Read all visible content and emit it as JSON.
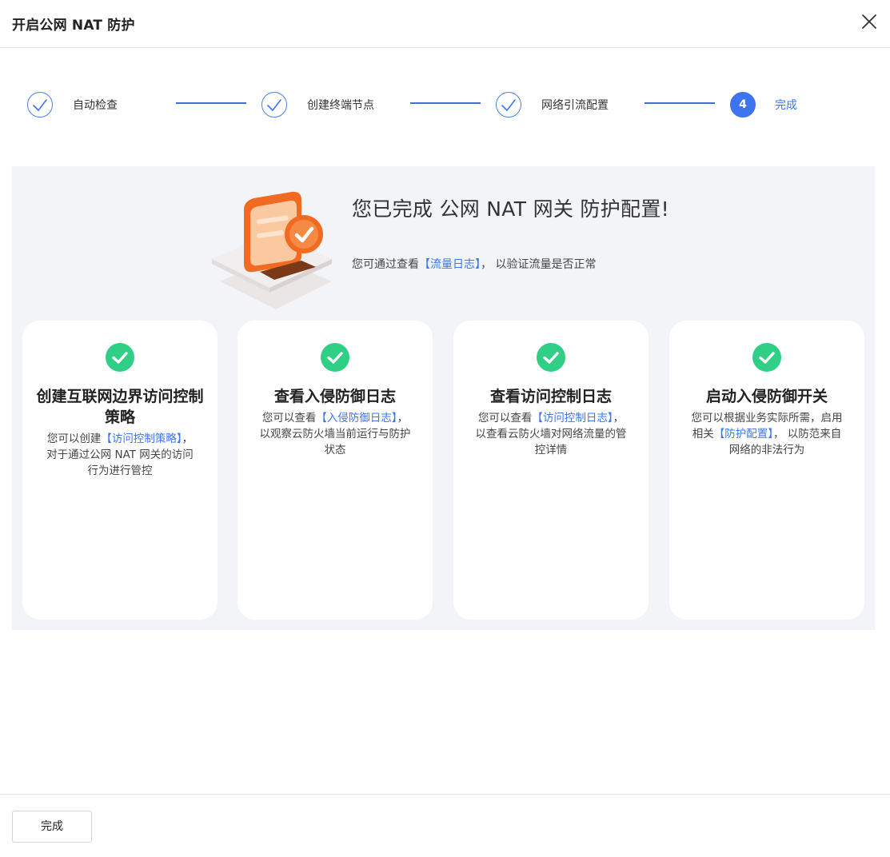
{
  "header": {
    "title": "开启公网 NAT 防护",
    "close_icon": "close-icon"
  },
  "steps": [
    {
      "label": "自动检查",
      "status": "done"
    },
    {
      "label": "创建终端节点",
      "status": "done"
    },
    {
      "label": "网络引流配置",
      "status": "done"
    },
    {
      "number": "4",
      "label": "完成",
      "status": "current"
    }
  ],
  "result": {
    "title": "您已完成 公网 NAT 网关 防护配置!",
    "subtitle_before": "您可通过查看",
    "subtitle_link": "【流量日志】",
    "subtitle_after": "， 以验证流量是否正常"
  },
  "cards": [
    {
      "title": "创建互联网边界访问控制策略",
      "desc_before": "您可以创建",
      "desc_link": "【访问控制策略】",
      "desc_after": "， 对于通过公网 NAT 网关的访问行为进行管控"
    },
    {
      "title": "查看入侵防御日志",
      "desc_before": "您可以查看",
      "desc_link": "【入侵防御日志】",
      "desc_after": "， 以观察云防火墙当前运行与防护状态"
    },
    {
      "title": "查看访问控制日志",
      "desc_before": "您可以查看",
      "desc_link": "【访问控制日志】",
      "desc_after": "， 以查看云防火墙对网络流量的管控详情"
    },
    {
      "title": "启动入侵防御开关",
      "desc_before": "您可以根据业务实际所需，启用相关",
      "desc_link": "【防护配置】",
      "desc_after": "， 以防范来自网络的非法行为"
    }
  ],
  "footer": {
    "finish_label": "完成"
  },
  "colors": {
    "accent": "#3d74f0",
    "success": "#2fcf86",
    "illustration": "#f26a21"
  }
}
